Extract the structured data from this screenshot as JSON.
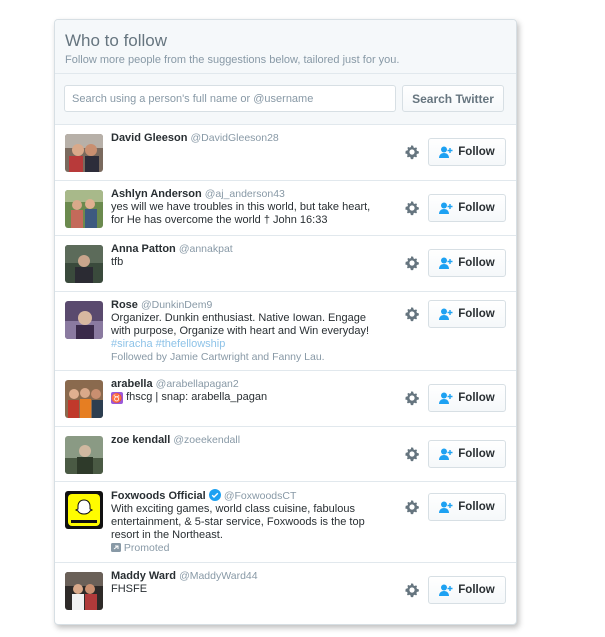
{
  "header": {
    "title": "Who to follow",
    "subtitle": "Follow more people from the suggestions below, tailored just for you."
  },
  "search": {
    "placeholder": "Search using a person's full name or @username",
    "button_label": "Search Twitter"
  },
  "follow_label": "Follow",
  "colors": {
    "link": "#1da1f2",
    "verified": "#1da1f2",
    "hashtag": "#8ec3e8",
    "muted": "#8899a6"
  },
  "users": [
    {
      "name": "David Gleeson",
      "handle": "@DavidGleeson28",
      "bio": ""
    },
    {
      "name": "Ashlyn Anderson",
      "handle": "@aj_anderson43",
      "bio": "yes will we have troubles in this world, but take heart, for He has overcome the world † John 16:33"
    },
    {
      "name": "Anna Patton",
      "handle": "@annakpat",
      "bio": "tfb"
    },
    {
      "name": "Rose",
      "handle": "@DunkinDem9",
      "bio": "Organizer. Dunkin enthusiast. Native Iowan. Engage with purpose, Organize with heart and Win everyday!",
      "tags": "#siracha #thefellowship",
      "followed_by": "Followed by Jamie Cartwright and Fanny Lau."
    },
    {
      "name": "arabella",
      "handle": "@arabellapagan2",
      "bio": "fhscg | snap: arabella_pagan",
      "bio_icon": "taurus-emoji-icon"
    },
    {
      "name": "zoe kendall",
      "handle": "@zoeekendall",
      "bio": ""
    },
    {
      "name": "Foxwoods Official",
      "handle": "@FoxwoodsCT",
      "verified": true,
      "bio": "With exciting games, world class cuisine, fabulous entertainment, & 5-star service, Foxwoods is the top resort in the Northeast.",
      "promoted": "Promoted"
    },
    {
      "name": "Maddy Ward",
      "handle": "@MaddyWard44",
      "bio": "FHSFE"
    }
  ]
}
